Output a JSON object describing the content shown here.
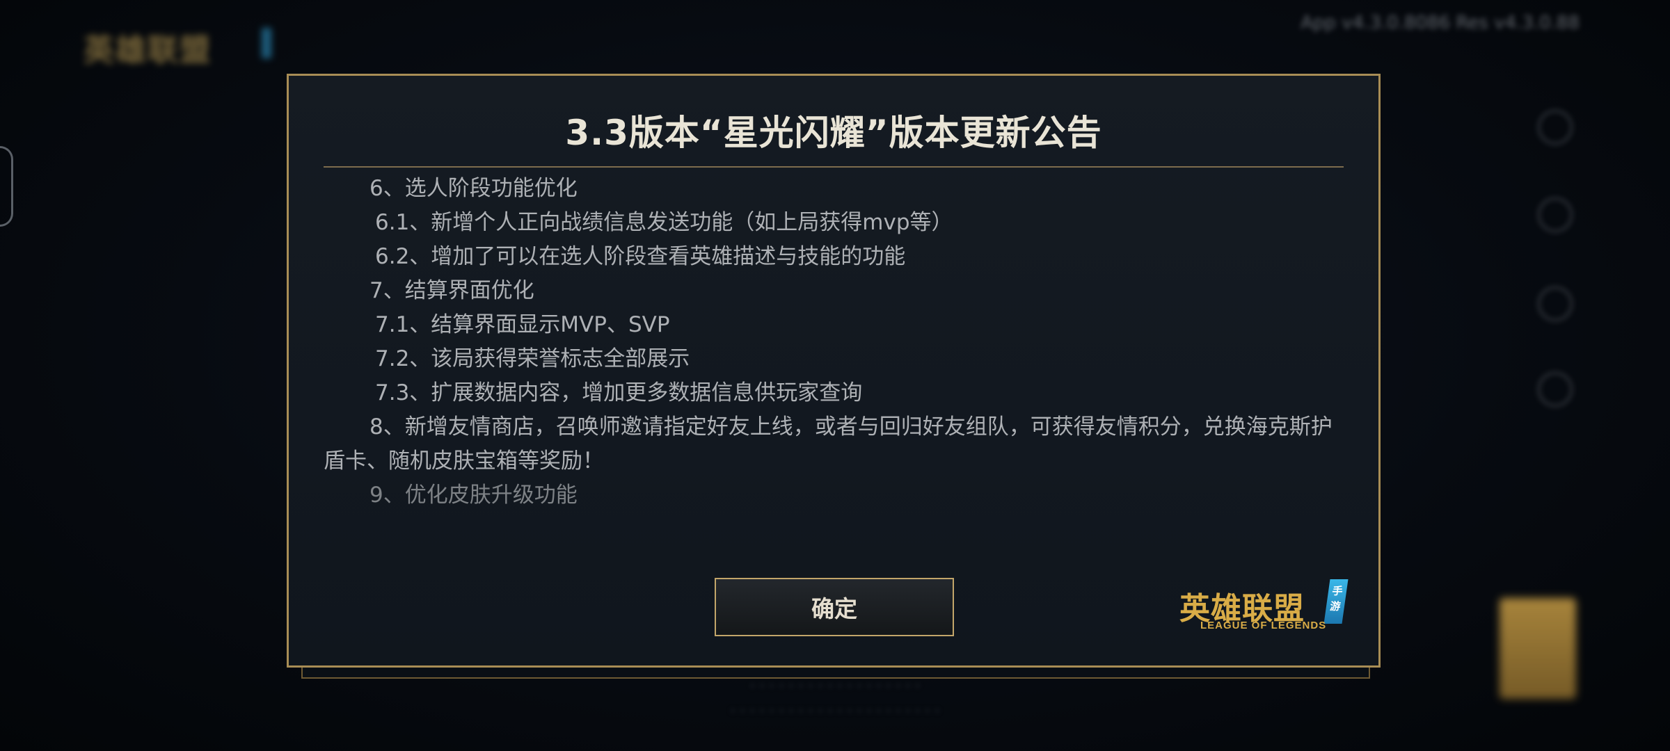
{
  "background": {
    "logo_text": "英雄联盟",
    "status_text": "App v4.3.0.8086 Res v4.3.0.88",
    "bottom_text_1": "· · · · · · · · · · · · · · · · · ·",
    "bottom_text_2": "· · · · · · · · · · · · · · · · · · · · · ·"
  },
  "dialog": {
    "title": "3.3版本“星光闪耀”版本更新公告",
    "lines": [
      "6、选人阶段功能优化",
      "6.1、新增个人正向战绩信息发送功能（如上局获得mvp等）",
      "6.2、增加了可以在选人阶段查看英雄描述与技能的功能",
      "7、结算界面优化",
      "7.1、结算界面显示MVP、SVP",
      "7.2、该局获得荣誉标志全部展示",
      "7.3、扩展数据内容，增加更多数据信息供玩家查询",
      "8、新增友情商店，召唤师邀请指定好友上线，或者与回归好友组队，可获得友情积分，兑换海克斯护盾卡、随机皮肤宝箱等奖励！",
      "9、优化皮肤升级功能"
    ],
    "confirm_label": "确定",
    "brand": {
      "cn": "英雄联盟",
      "badge": "手游",
      "en": "LEAGUE OF LEGENDS"
    }
  },
  "colors": {
    "gold_border": "#a88d55",
    "brand_gold": "#d9ac47",
    "brand_blue": "#3ab7e8",
    "text": "#aeb1b5",
    "title": "#e9e4d6"
  }
}
